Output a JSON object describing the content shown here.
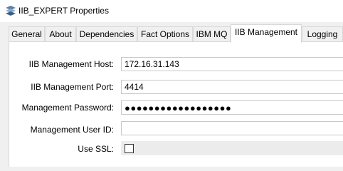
{
  "window": {
    "title": "IIB_EXPERT Properties",
    "icon": "app-logo-icon"
  },
  "tabs": [
    {
      "label": "General",
      "active": false
    },
    {
      "label": "About",
      "active": false
    },
    {
      "label": "Dependencies",
      "active": false
    },
    {
      "label": "Fact Options",
      "active": false
    },
    {
      "label": "IBM MQ",
      "active": false
    },
    {
      "label": "IIB Management",
      "active": true
    },
    {
      "label": "Logging",
      "active": false
    }
  ],
  "form": {
    "host_label": "IIB Management Host:",
    "host_value": "172.16.31.143",
    "port_label": "IIB Management Port:",
    "port_value": "4414",
    "password_label": "Management Password:",
    "password_value": "●●●●●●●●●●●●●●●●●●",
    "userid_label": "Management User ID:",
    "userid_value": "",
    "ssl_label": "Use SSL:",
    "ssl_checked": false
  }
}
